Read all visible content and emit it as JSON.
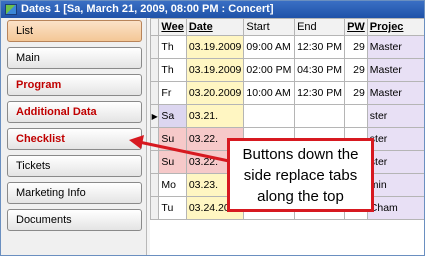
{
  "window": {
    "title": "Dates  1 [Sa, March  21, 2009, 08:00 PM : Concert]",
    "icon": "calendar-app-icon"
  },
  "sidebar": {
    "items": [
      {
        "label": "List",
        "style": "active"
      },
      {
        "label": "Main",
        "style": "normal"
      },
      {
        "label": "Program",
        "style": "red"
      },
      {
        "label": "Additional Data",
        "style": "red"
      },
      {
        "label": "Checklist",
        "style": "red"
      },
      {
        "label": "Tickets",
        "style": "normal"
      },
      {
        "label": "Marketing Info",
        "style": "normal"
      },
      {
        "label": "Documents",
        "style": "normal"
      }
    ]
  },
  "table": {
    "headers": {
      "weekday": "Wee",
      "date": "Date",
      "start": "Start",
      "end": "End",
      "pw": "PW",
      "project": "Projec"
    },
    "rows": [
      {
        "weekday": "Th",
        "date": "03.19.2009",
        "start": "09:00 AM",
        "end": "12:30 PM",
        "pw": "29",
        "project": "Master"
      },
      {
        "weekday": "Th",
        "date": "03.19.2009",
        "start": "02:00 PM",
        "end": "04:30 PM",
        "pw": "29",
        "project": "Master"
      },
      {
        "weekday": "Fr",
        "date": "03.20.2009",
        "start": "10:00 AM",
        "end": "12:30 PM",
        "pw": "29",
        "project": "Master"
      },
      {
        "weekday": "Sa",
        "date": "03.21.",
        "start": "",
        "end": "",
        "pw": "",
        "project": "ster"
      },
      {
        "weekday": "Su",
        "date": "03.22.",
        "start": "",
        "end": "",
        "pw": "",
        "project": "ster"
      },
      {
        "weekday": "Su",
        "date": "03.22.",
        "start": "",
        "end": "",
        "pw": "",
        "project": "ster"
      },
      {
        "weekday": "Mo",
        "date": "03.23.",
        "start": "",
        "end": "",
        "pw": "",
        "project": "min"
      },
      {
        "weekday": "Tu",
        "date": "03.24.2009",
        "start": "07:00 PM",
        "end": "09:30 PM",
        "pw": "30",
        "project": "Cham"
      }
    ]
  },
  "callout": {
    "text": "Buttons down the side replace tabs along the top",
    "border_color": "#d71920"
  }
}
